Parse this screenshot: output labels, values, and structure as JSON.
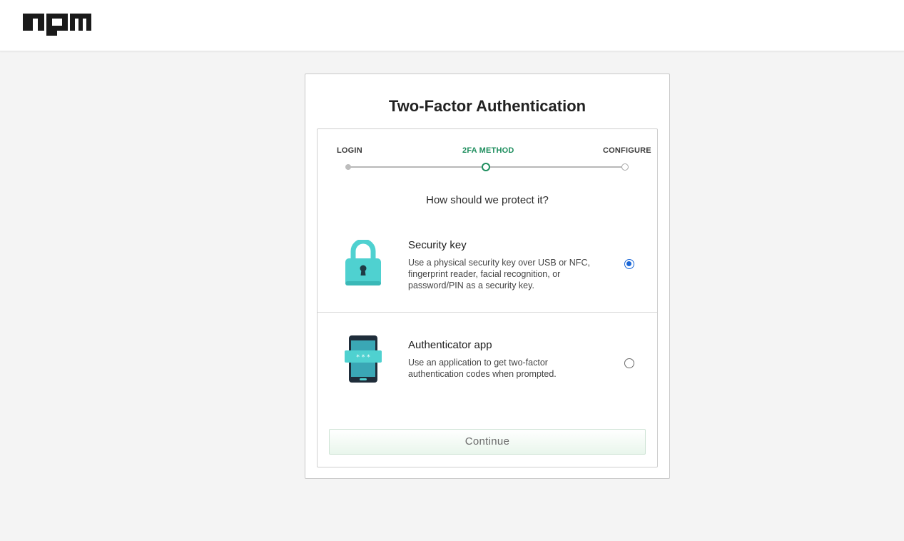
{
  "header": {
    "logo_text": "npm",
    "logo_icon": "npm-logo"
  },
  "card": {
    "title": "Two-Factor Authentication",
    "steps": [
      {
        "label": "LOGIN",
        "state": "done"
      },
      {
        "label": "2FA METHOD",
        "state": "current"
      },
      {
        "label": "CONFIGURE",
        "state": "upcoming"
      }
    ],
    "question": "How should we protect it?",
    "options": [
      {
        "title": "Security key",
        "description": "Use a physical security key over USB or NFC, fingerprint reader, facial recognition, or password/PIN as a security key.",
        "icon": "padlock-icon",
        "selected": true
      },
      {
        "title": "Authenticator app",
        "description": "Use an application to get two-factor authentication codes when prompted.",
        "icon": "phone-icon",
        "selected": false
      }
    ],
    "continue_label": "Continue"
  },
  "colors": {
    "accent_green": "#1e8e5e",
    "radio_blue": "#1a66d6",
    "icon_teal": "#4fd1d0",
    "page_bg": "#f4f4f4"
  }
}
